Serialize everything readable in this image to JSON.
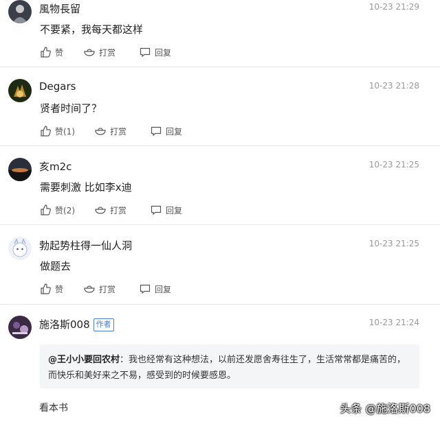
{
  "actions": {
    "reply_label": "回复"
  },
  "comments": [
    {
      "user": "風物長留",
      "time": "10-23 21:29",
      "text": "不要紧，我每天都这样",
      "like_label": "赞",
      "tip_label": "打赏"
    },
    {
      "user": "Degars",
      "time": "10-23 21:28",
      "text": "贤者时间了？",
      "like_label": "赞(1)",
      "tip_label": "打赏"
    },
    {
      "user": "亥m2c",
      "time": "10-23 21:25",
      "text": "需要刺激 比如李x迪",
      "like_label": "赞(2)",
      "tip_label": "打赏"
    },
    {
      "user": "勃起势柱得一仙人洞",
      "time": "10-23 21:25",
      "text": "做题去",
      "like_label": "赞",
      "tip_label": "打赏"
    },
    {
      "user": "施洛斯008",
      "time": "10-23 21:24",
      "badge": "作者"
    }
  ],
  "quote": {
    "user": "@王小小要回农村",
    "separator": "：",
    "text": "我也经常有这种想法，以前还发愿舍寿往生了，生活常常都是痛苦的，而快乐和美好来之不易，感受到的时候要感恩。"
  },
  "more_label": "看本书",
  "watermark": "头条 @施洛斯008",
  "colors": {
    "badge": "#4a7fd6",
    "quote_bg": "#f4f5f7",
    "divider": "#e8e8e8",
    "time": "#999999"
  }
}
